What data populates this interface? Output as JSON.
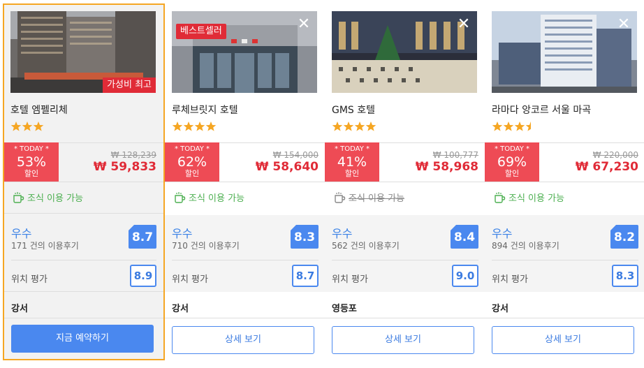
{
  "hotels": [
    {
      "name": "호텔 엠펠리체",
      "badge": "가성비 최고",
      "stars": 3,
      "today_label": "* TODAY *",
      "discount": "53%",
      "discount_label": "할인",
      "original_price": "₩ 128,239",
      "sale_price": "₩ 59,833",
      "breakfast": "조식 이용 가능",
      "breakfast_available": true,
      "grade": "우수",
      "reviews": "171 건의 이용후기",
      "score": "8.7",
      "location_label": "위치 평가",
      "location_score": "8.9",
      "area": "강서",
      "button": "지금 예약하기"
    },
    {
      "name": "루체브릿지 호텔",
      "badge": "베스트셀러",
      "stars": 4,
      "today_label": "* TODAY *",
      "discount": "62%",
      "discount_label": "할인",
      "original_price": "₩ 154,000",
      "sale_price": "₩ 58,640",
      "breakfast": "조식 이용 가능",
      "breakfast_available": true,
      "grade": "우수",
      "reviews": "710 건의 이용후기",
      "score": "8.3",
      "location_label": "위치 평가",
      "location_score": "8.7",
      "area": "강서",
      "button": "상세 보기"
    },
    {
      "name": "GMS 호텔",
      "stars": 4,
      "today_label": "* TODAY *",
      "discount": "41%",
      "discount_label": "할인",
      "original_price": "₩ 100,777",
      "sale_price": "₩ 58,968",
      "breakfast": "조식 이용 가능",
      "breakfast_available": false,
      "grade": "우수",
      "reviews": "562 건의 이용후기",
      "score": "8.4",
      "location_label": "위치 평가",
      "location_score": "9.0",
      "area": "영등포",
      "button": "상세 보기"
    },
    {
      "name": "라마다 앙코르 서울 마곡",
      "stars": 3.5,
      "today_label": "* TODAY *",
      "discount": "69%",
      "discount_label": "할인",
      "original_price": "₩ 220,000",
      "sale_price": "₩ 67,230",
      "breakfast": "조식 이용 가능",
      "breakfast_available": true,
      "grade": "우수",
      "reviews": "894 건의 이용후기",
      "score": "8.2",
      "location_label": "위치 평가",
      "location_score": "8.3",
      "area": "강서",
      "button": "상세 보기"
    }
  ],
  "icons": {
    "close": "close-icon",
    "star": "star-icon",
    "breakfast": "coffee-cup-icon"
  },
  "colors": {
    "accent_blue": "#4a88ef",
    "sale_red": "#e02b37",
    "today_red": "#ee4b55",
    "breakfast_green": "#4caf50",
    "star_orange": "#f5a623",
    "selected_border": "#f5a623"
  }
}
